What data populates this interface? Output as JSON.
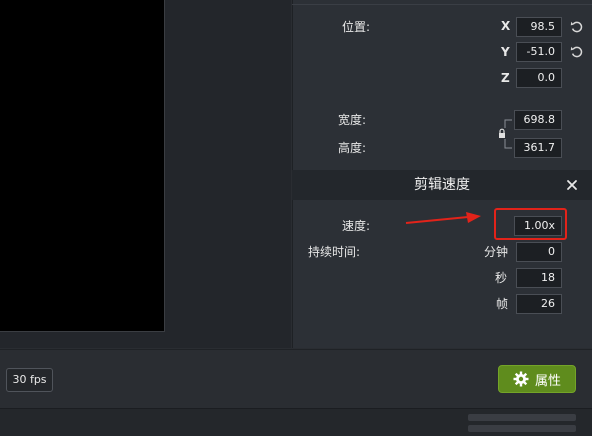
{
  "position": {
    "label": "位置:",
    "x_label": "X",
    "x_value": "98.5",
    "y_label": "Y",
    "y_value": "-51.0",
    "z_label": "Z",
    "z_value": "0.0"
  },
  "size": {
    "width_label": "宽度:",
    "width_value": "698.8",
    "height_label": "高度:",
    "height_value": "361.7"
  },
  "speed_section": {
    "title": "剪辑速度",
    "speed_label": "速度:",
    "speed_value": "1.00x",
    "duration_label": "持续时间:",
    "minutes_label": "分钟",
    "minutes_value": "0",
    "seconds_label": "秒",
    "seconds_value": "18",
    "frames_label": "帧",
    "frames_value": "26"
  },
  "footer": {
    "fps": "30 fps",
    "properties_button": "属性"
  },
  "colors": {
    "highlight": "#e2231a",
    "button_green": "#5f8c1d"
  },
  "icons": [
    "reset-icon",
    "lock-icon",
    "close-icon",
    "gear-icon",
    "arrow-annotation"
  ]
}
